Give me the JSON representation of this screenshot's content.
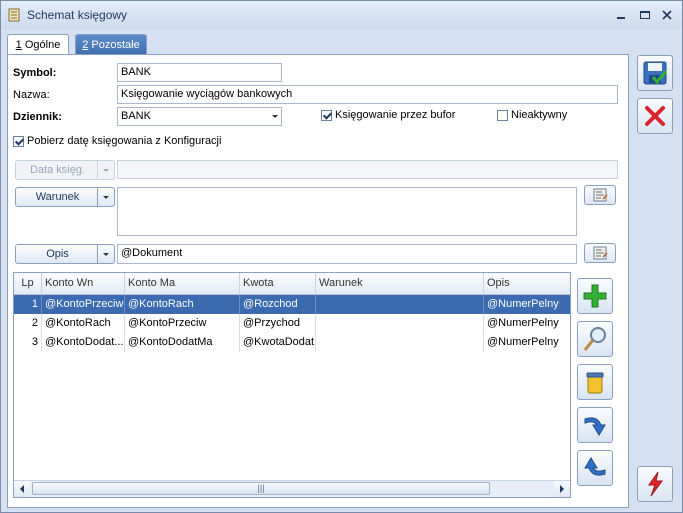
{
  "window": {
    "title": "Schemat księgowy"
  },
  "tabs": [
    {
      "key": "1",
      "label": " Ogólne"
    },
    {
      "key": "2",
      "label": " Pozostałe"
    }
  ],
  "form": {
    "symbol_label": "Symbol:",
    "symbol_value": "BANK",
    "nazwa_label": "Nazwa:",
    "nazwa_value": "Księgowanie wyciągów bankowych",
    "dziennik_label": "Dziennik:",
    "dziennik_value": "BANK",
    "bufor_label": "Księgowanie przez bufor",
    "bufor_checked": true,
    "nieaktywny_label": "Nieaktywny",
    "nieaktywny_checked": false,
    "pobierz_label": "Pobierz datę księgowania z Konfiguracji",
    "pobierz_checked": true,
    "data_ksieg_label": "Data księg.",
    "data_ksieg_value": "",
    "warunek_label": "Warunek",
    "warunek_value": "",
    "opis_label": "Opis",
    "opis_value": "@Dokument"
  },
  "grid": {
    "columns": [
      "Lp",
      "Konto Wn",
      "Konto Ma",
      "Kwota",
      "Warunek",
      "Opis"
    ],
    "rows": [
      {
        "lp": "1",
        "wn": "@KontoPrzeciw",
        "ma": "@KontoRach",
        "kwota": "@Rozchod",
        "warunek": "",
        "opis": "@NumerPelny"
      },
      {
        "lp": "2",
        "wn": "@KontoRach",
        "ma": "@KontoPrzeciw",
        "kwota": "@Przychod",
        "warunek": "",
        "opis": "@NumerPelny"
      },
      {
        "lp": "3",
        "wn": "@KontoDodat...",
        "ma": "@KontoDodatMa",
        "kwota": "@KwotaDodat",
        "warunek": "",
        "opis": "@NumerPelny"
      }
    ],
    "selected_row": 0
  },
  "colors": {
    "accent": "#3c6ab1",
    "tab_inactive": "#4a7bbd",
    "delete_red": "#d8262c",
    "add_green": "#35b034"
  }
}
